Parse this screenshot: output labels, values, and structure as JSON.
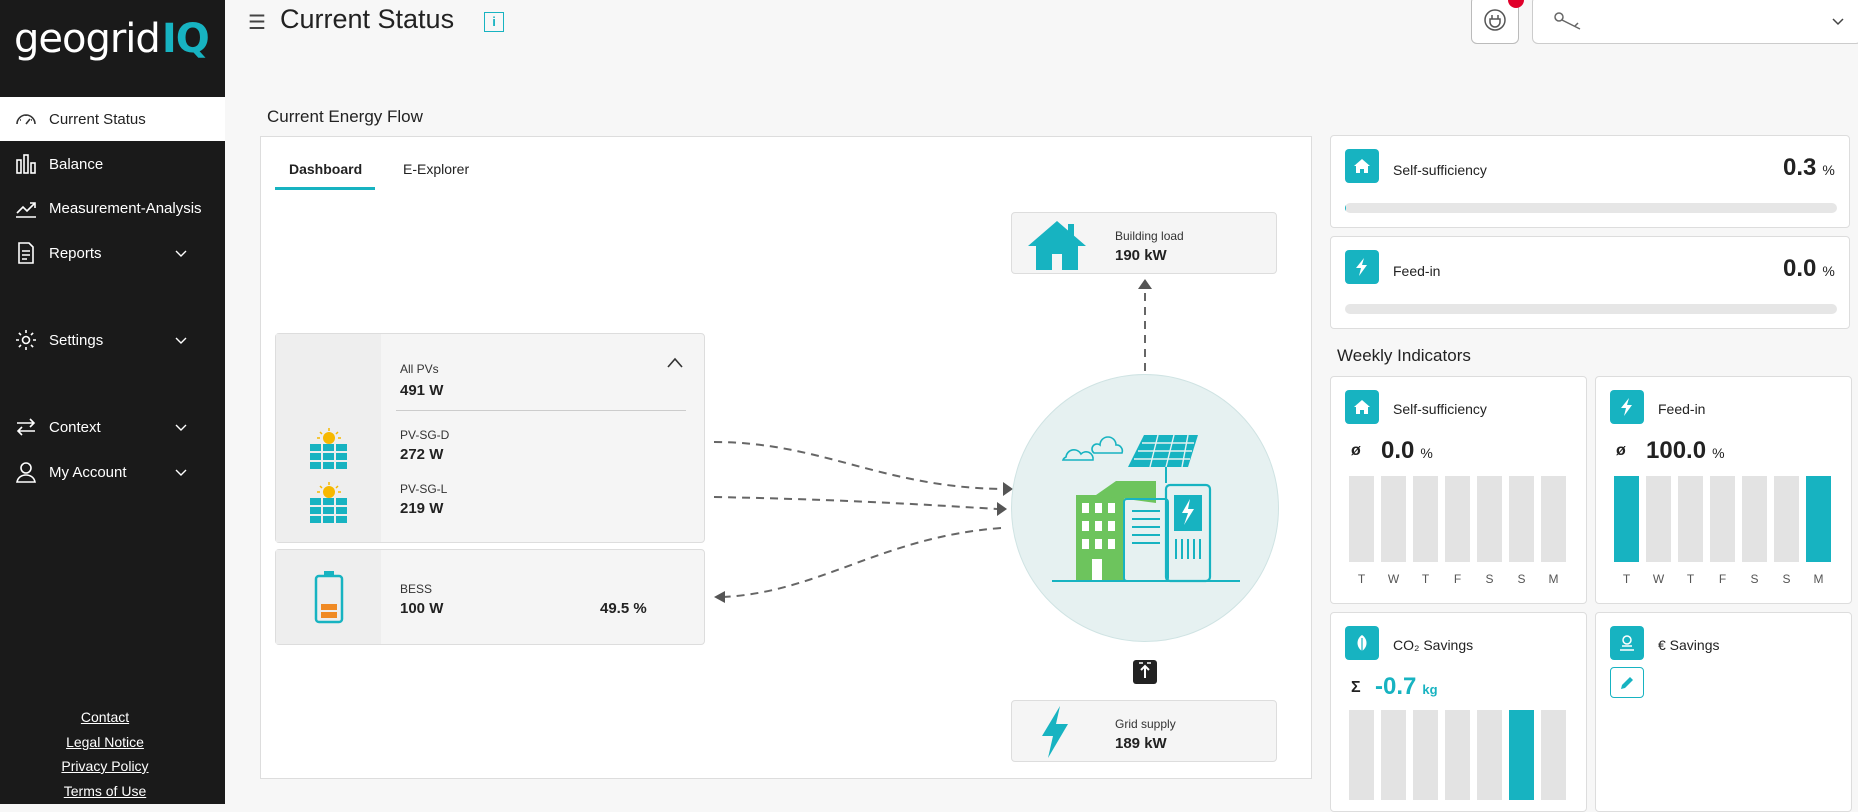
{
  "logo": {
    "main": "geogrid",
    "accent": "IQ"
  },
  "sidebar": {
    "items": [
      {
        "label": "Current Status",
        "icon": "gauge-icon"
      },
      {
        "label": "Balance",
        "icon": "bar-chart-icon"
      },
      {
        "label": "Measurement-Analysis",
        "icon": "line-chart-icon"
      },
      {
        "label": "Reports",
        "icon": "document-icon"
      },
      {
        "label": "Settings",
        "icon": "gear-icon"
      },
      {
        "label": "Context",
        "icon": "swap-icon"
      },
      {
        "label": "My Account",
        "icon": "user-icon"
      }
    ],
    "footer": [
      "Contact",
      "Legal Notice",
      "Privacy Policy",
      "Terms of Use"
    ]
  },
  "header": {
    "title": "Current Status",
    "info": "i"
  },
  "flow": {
    "section_title": "Current Energy Flow",
    "tabs": [
      "Dashboard",
      "E-Explorer"
    ],
    "building": {
      "label": "Building load",
      "value": "190 kW"
    },
    "grid": {
      "label": "Grid supply",
      "value": "189 kW"
    },
    "pv_total": {
      "label": "All PVs",
      "value": "491 W"
    },
    "pv_items": [
      {
        "label": "PV-SG-D",
        "value": "272 W"
      },
      {
        "label": "PV-SG-L",
        "value": "219 W"
      }
    ],
    "bess": {
      "label": "BESS",
      "value": "100 W",
      "soc": "49.5 %"
    }
  },
  "current_kpis": [
    {
      "label": "Self-sufficiency",
      "value": "0.3",
      "unit": "%",
      "progress": 0.3
    },
    {
      "label": "Feed-in",
      "value": "0.0",
      "unit": "%",
      "progress": 0
    }
  ],
  "weekly": {
    "title": "Weekly Indicators",
    "days": [
      "T",
      "W",
      "T",
      "F",
      "S",
      "S",
      "M"
    ],
    "self_sufficiency": {
      "label": "Self-sufficiency",
      "prefix": "ø",
      "value": "0.0",
      "unit": "%",
      "bars": [
        0,
        0,
        0,
        0,
        0,
        0,
        0
      ]
    },
    "feed_in": {
      "label": "Feed-in",
      "prefix": "ø",
      "value": "100.0",
      "unit": "%",
      "bars": [
        1,
        0,
        0,
        0,
        0,
        0,
        1
      ]
    },
    "co2": {
      "label": "CO₂ Savings",
      "prefix": "Σ",
      "value": "-0.7",
      "unit": "kg",
      "bars": [
        0,
        0,
        0,
        0,
        0,
        1,
        0
      ]
    },
    "eur": {
      "label": "€ Savings"
    }
  },
  "colors": {
    "accent": "#17b3c1",
    "sidebar": "#1a1a1a",
    "notification": "#e0002a"
  }
}
